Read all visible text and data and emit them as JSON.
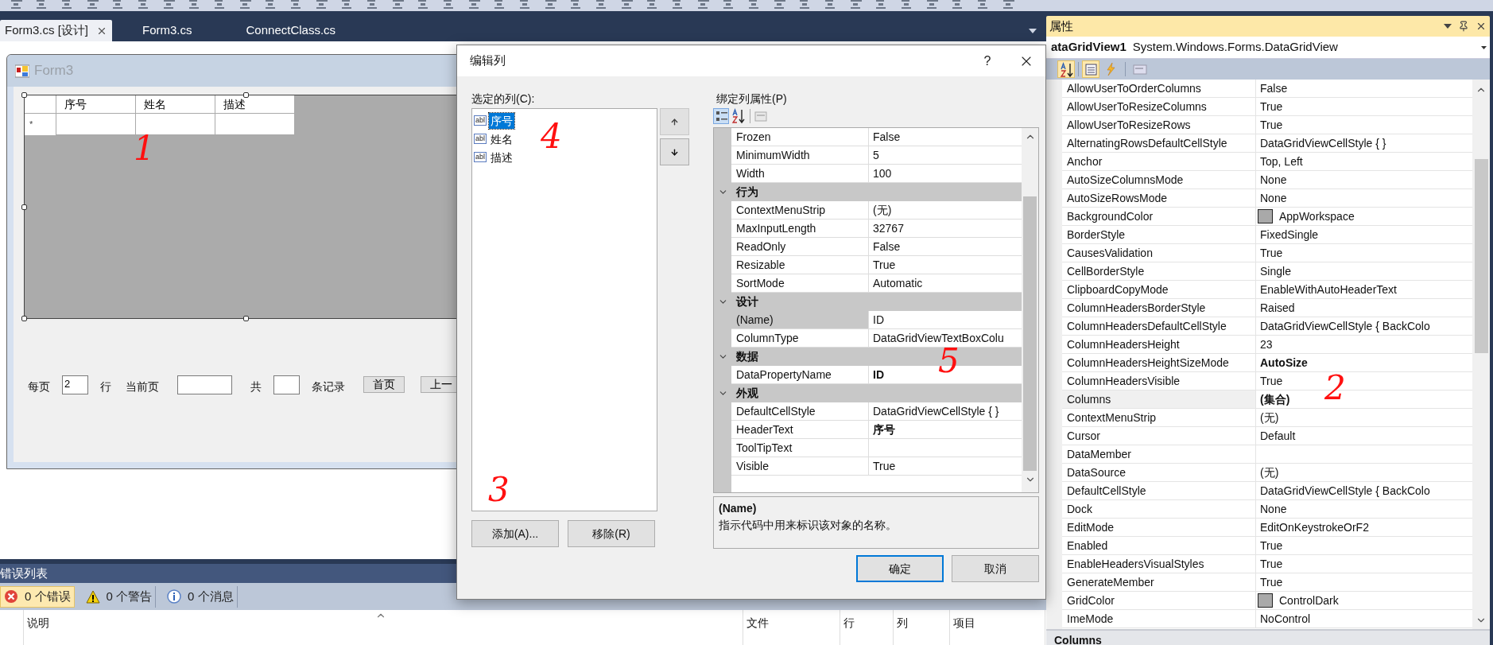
{
  "designer_tabs": [
    {
      "label": "Form3.cs [设计]",
      "selected": true,
      "closable": true
    },
    {
      "label": "Form3.cs",
      "selected": false,
      "closable": false
    },
    {
      "label": "ConnectClass.cs",
      "selected": false,
      "closable": false
    }
  ],
  "form": {
    "title": "Form3",
    "grid": {
      "columns": [
        "序号",
        "姓名",
        "描述"
      ],
      "new_row_marker": "*"
    },
    "pager": [
      {
        "kind": "label",
        "text": "每页"
      },
      {
        "kind": "input",
        "value": "2"
      },
      {
        "kind": "label",
        "text": "行"
      },
      {
        "kind": "label",
        "text": "当前页"
      },
      {
        "kind": "wide_input"
      },
      {
        "kind": "label",
        "text": "共"
      },
      {
        "kind": "input"
      },
      {
        "kind": "label",
        "text": "条记录"
      },
      {
        "kind": "button",
        "text": "首页"
      },
      {
        "kind": "button",
        "text": "上一"
      }
    ]
  },
  "error_list": {
    "title": "错误列表",
    "filters": [
      {
        "kind": "error",
        "label": "0 个错误",
        "selected": true
      },
      {
        "kind": "warning",
        "label": "0 个警告",
        "selected": false
      },
      {
        "kind": "info",
        "label": "0 个消息",
        "selected": false
      }
    ],
    "columns": [
      "说明",
      "文件",
      "行",
      "列",
      "项目"
    ]
  },
  "dialog": {
    "title": "编辑列",
    "help": "?",
    "left_label": "选定的列(C):",
    "columns": [
      {
        "icon": "abl",
        "label": "序号",
        "selected": true
      },
      {
        "icon": "abl",
        "label": "姓名",
        "selected": false
      },
      {
        "icon": "abl",
        "label": "描述",
        "selected": false
      }
    ],
    "add_button": "添加(A)...",
    "remove_button": "移除(R)",
    "right_label": "绑定列属性(P)",
    "sections": [
      {
        "expanded": true,
        "properties": [
          {
            "name": "Frozen",
            "value": "False",
            "kind": "text",
            "selected": false
          },
          {
            "name": "MinimumWidth",
            "value": "5",
            "kind": "text",
            "selected": false
          },
          {
            "name": "Width",
            "value": "100",
            "kind": "text",
            "selected": false
          }
        ]
      },
      {
        "title": "行为",
        "expanded": true,
        "properties": [
          {
            "name": "ContextMenuStrip",
            "value": "(无)",
            "kind": "text",
            "selected": false
          },
          {
            "name": "MaxInputLength",
            "value": "32767",
            "kind": "text",
            "selected": false
          },
          {
            "name": "ReadOnly",
            "value": "False",
            "kind": "text",
            "selected": false
          },
          {
            "name": "Resizable",
            "value": "True",
            "kind": "text",
            "selected": false
          },
          {
            "name": "SortMode",
            "value": "Automatic",
            "kind": "text",
            "selected": false
          }
        ]
      },
      {
        "title": "设计",
        "expanded": true,
        "properties": [
          {
            "name": "(Name)",
            "value": "ID",
            "kind": "text",
            "selected": true
          },
          {
            "name": "ColumnType",
            "value": "DataGridViewTextBoxColu",
            "kind": "text",
            "selected": false
          }
        ]
      },
      {
        "title": "数据",
        "expanded": true,
        "properties": [
          {
            "name": "DataPropertyName",
            "value": "ID",
            "kind": "bold",
            "selected": false
          }
        ]
      },
      {
        "title": "外观",
        "expanded": true,
        "properties": [
          {
            "name": "DefaultCellStyle",
            "value": "DataGridViewCellStyle { }",
            "kind": "text",
            "selected": false
          },
          {
            "name": "HeaderText",
            "value": "序号",
            "kind": "bold",
            "selected": false
          },
          {
            "name": "ToolTipText",
            "kind": "text",
            "selected": false
          },
          {
            "name": "Visible",
            "value": "True",
            "kind": "text",
            "selected": false
          }
        ]
      }
    ],
    "description": {
      "title": "(Name)",
      "text": "指示代码中用来标识该对象的名称。"
    },
    "ok_button": "确定",
    "cancel_button": "取消"
  },
  "properties": {
    "title": "属性",
    "object_name": "ataGridView1",
    "object_type": "System.Windows.Forms.DataGridView",
    "rows": [
      {
        "name": "AllowUserToOrderColumns",
        "value": "False",
        "kind": "text",
        "selected": false
      },
      {
        "name": "AllowUserToResizeColumns",
        "value": "True",
        "kind": "text",
        "selected": false
      },
      {
        "name": "AllowUserToResizeRows",
        "value": "True",
        "kind": "text",
        "selected": false
      },
      {
        "name": "AlternatingRowsDefaultCellStyle",
        "value": "DataGridViewCellStyle { }",
        "kind": "text",
        "selected": false
      },
      {
        "name": "Anchor",
        "value": "Top, Left",
        "kind": "text",
        "selected": false
      },
      {
        "name": "AutoSizeColumnsMode",
        "value": "None",
        "kind": "text",
        "selected": false
      },
      {
        "name": "AutoSizeRowsMode",
        "value": "None",
        "kind": "text",
        "selected": false
      },
      {
        "name": "BackgroundColor",
        "value": "AppWorkspace",
        "kind": "color",
        "selected": false
      },
      {
        "name": "BorderStyle",
        "value": "FixedSingle",
        "kind": "text",
        "selected": false
      },
      {
        "name": "CausesValidation",
        "value": "True",
        "kind": "text",
        "selected": false
      },
      {
        "name": "CellBorderStyle",
        "value": "Single",
        "kind": "text",
        "selected": false
      },
      {
        "name": "ClipboardCopyMode",
        "value": "EnableWithAutoHeaderText",
        "kind": "text",
        "selected": false
      },
      {
        "name": "ColumnHeadersBorderStyle",
        "value": "Raised",
        "kind": "text",
        "selected": false
      },
      {
        "name": "ColumnHeadersDefaultCellStyle",
        "value": "DataGridViewCellStyle { BackColo",
        "kind": "text",
        "selected": false
      },
      {
        "name": "ColumnHeadersHeight",
        "value": "23",
        "kind": "text",
        "selected": false
      },
      {
        "name": "ColumnHeadersHeightSizeMode",
        "value": "AutoSize",
        "kind": "bold",
        "selected": false
      },
      {
        "name": "ColumnHeadersVisible",
        "value": "True",
        "kind": "text",
        "selected": false
      },
      {
        "name": "Columns",
        "value": "(集合)",
        "kind": "bold",
        "selected": true
      },
      {
        "name": "ContextMenuStrip",
        "value": "(无)",
        "kind": "text",
        "selected": false
      },
      {
        "name": "Cursor",
        "value": "Default",
        "kind": "text",
        "selected": false
      },
      {
        "name": "DataMember",
        "kind": "text",
        "selected": false
      },
      {
        "name": "DataSource",
        "value": "(无)",
        "kind": "text",
        "selected": false
      },
      {
        "name": "DefaultCellStyle",
        "value": "DataGridViewCellStyle { BackColo",
        "kind": "text",
        "selected": false
      },
      {
        "name": "Dock",
        "value": "None",
        "kind": "text",
        "selected": false
      },
      {
        "name": "EditMode",
        "value": "EditOnKeystrokeOrF2",
        "kind": "text",
        "selected": false
      },
      {
        "name": "Enabled",
        "value": "True",
        "kind": "text",
        "selected": false
      },
      {
        "name": "EnableHeadersVisualStyles",
        "value": "True",
        "kind": "text",
        "selected": false
      },
      {
        "name": "GenerateMember",
        "value": "True",
        "kind": "text",
        "selected": false
      },
      {
        "name": "GridColor",
        "value": "ControlDark",
        "kind": "color",
        "selected": false
      },
      {
        "name": "ImeMode",
        "value": "NoControl",
        "kind": "text",
        "selected": false
      }
    ],
    "footer": "Columns"
  },
  "annotations": [
    {
      "text": "1"
    },
    {
      "text": "4"
    },
    {
      "text": "3"
    },
    {
      "text": "5"
    },
    {
      "text": "2"
    }
  ]
}
